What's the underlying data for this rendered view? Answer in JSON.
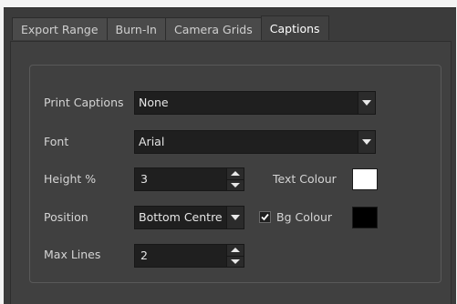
{
  "tabs": [
    {
      "label": "Export Range",
      "active": false
    },
    {
      "label": "Burn-In",
      "active": false
    },
    {
      "label": "Camera Grids",
      "active": false
    },
    {
      "label": "Captions",
      "active": true
    }
  ],
  "captions": {
    "print_captions": {
      "label": "Print Captions",
      "value": "None"
    },
    "font": {
      "label": "Font",
      "value": "Arial"
    },
    "height": {
      "label": "Height %",
      "value": "3"
    },
    "text_colour": {
      "label": "Text Colour",
      "color": "#ffffff"
    },
    "position": {
      "label": "Position",
      "value": "Bottom Centre"
    },
    "bg_colour": {
      "label": "Bg Colour",
      "checked": true,
      "color": "#000000"
    },
    "max_lines": {
      "label": "Max Lines",
      "value": "2"
    }
  },
  "icons": {
    "dropdown": "chevron-down-icon",
    "spin_up": "spin-up-icon",
    "spin_down": "spin-down-icon",
    "check": "check-icon"
  },
  "colors": {
    "window_bg": "#3b3b3b",
    "pane_bg": "#404040",
    "field_bg": "#1f1f1f",
    "text": "#d4d4d4"
  }
}
